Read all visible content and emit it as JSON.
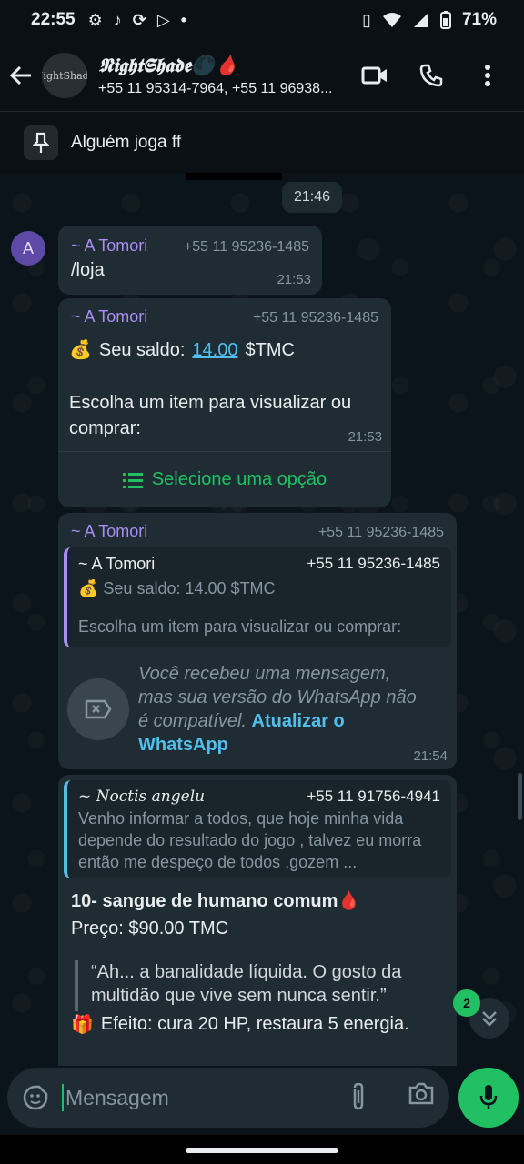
{
  "status_bar": {
    "time": "22:55",
    "battery": "71%"
  },
  "header": {
    "avatar_text": "NightShade",
    "title": "𝕹𝖎𝖌𝖍𝖙𝕾𝖍𝖆𝖉𝖊🌑🩸",
    "subtitle": "+55 11 95314-7964, +55 11 96938..."
  },
  "pinned": {
    "text": "Alguém joga ff"
  },
  "chat": {
    "date_chip": "21:46",
    "avatar_letter": "A",
    "messages": [
      {
        "sender": "~ A Tomori",
        "phone": "+55 11 95236-1485",
        "text": "/loja",
        "time": "21:53"
      },
      {
        "sender": "~ A Tomori",
        "phone": "+55 11 95236-1485",
        "saldo_emoji": "💰",
        "saldo_prefix": "Seu saldo:",
        "saldo_value": "14.00",
        "saldo_suffix": "$TMC",
        "text": "Escolha um item para visualizar ou comprar:",
        "time": "21:53",
        "option_label": "Selecione uma opção"
      },
      {
        "sender": "~ A Tomori",
        "phone": "+55 11 95236-1485",
        "quote_name": "~ A Tomori",
        "quote_phone": "+55 11 95236-1485",
        "quote_line1": "💰 Seu saldo: 14.00 $TMC",
        "quote_line2": "Escolha um item para visualizar ou comprar:",
        "unsupported_text": "Você recebeu uma mensagem, mas sua versão do WhatsApp não é compatível.",
        "update_link": "Atualizar o WhatsApp",
        "time": "21:54"
      },
      {
        "quote_name": "~ Noctis angelu",
        "quote_phone": "+55 11 91756-4941",
        "quote_body": "Venho informar a todos, que hoje minha vida depende do resultado do jogo , talvez eu morra então me despeço de todos ,gozem ...",
        "title": "10- sangue de humano comum🩸",
        "price": "Preço: $90.00 TMC",
        "quote_text": "“Ah... a banalidade líquida. O gosto da multidão que vive sem nunca sentir.”",
        "effect_emoji": "🎁",
        "effect": "Efeito: cura 20 HP, restaura 5 energia."
      }
    ],
    "unread_count": "2"
  },
  "input": {
    "placeholder": "Mensagem"
  },
  "colors": {
    "accent": "#21c063",
    "link": "#53bdeb",
    "sender": "#a88ef5",
    "bubble": "#1f2c33"
  }
}
